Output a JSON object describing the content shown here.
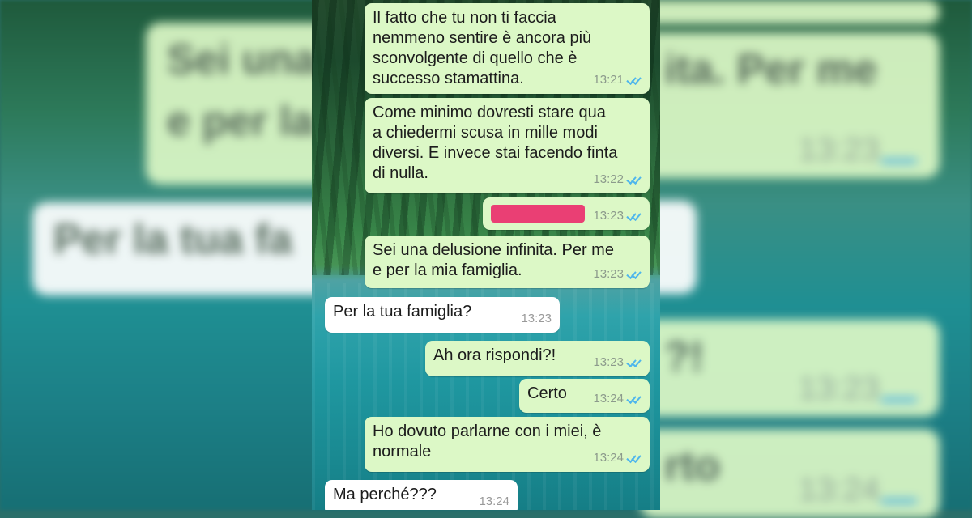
{
  "colors": {
    "outgoing_bubble": "#dcf8c6",
    "incoming_bubble": "#ffffff",
    "read_ticks": "#4fb6ec",
    "redaction": "#ea3f74"
  },
  "messages": [
    {
      "direction": "outgoing",
      "text": "Il fatto che tu non ti faccia\nnemmeno sentire è ancora più\nsconvolgente di quello che è\nsuccesso stamattina.",
      "time": "13:21",
      "status": "read"
    },
    {
      "direction": "outgoing",
      "text": "Come minimo dovresti stare qua\na chiedermi scusa in mille modi\ndiversi. E invece stai facendo finta\ndi nulla.",
      "time": "13:22",
      "status": "read"
    },
    {
      "direction": "outgoing",
      "text": "",
      "redacted": true,
      "time": "13:23",
      "status": "read"
    },
    {
      "direction": "outgoing",
      "text": "Sei una delusione infinita. Per me\ne per la mia famiglia.",
      "time": "13:23",
      "status": "read"
    },
    {
      "direction": "incoming",
      "text": "Per la tua famiglia?",
      "time": "13:23"
    },
    {
      "direction": "outgoing",
      "text": "Ah ora rispondi?!",
      "time": "13:23",
      "status": "read"
    },
    {
      "direction": "outgoing",
      "text": "Certo",
      "time": "13:24",
      "status": "read"
    },
    {
      "direction": "outgoing",
      "text": "Ho dovuto parlarne con i miei, è\nnormale",
      "time": "13:24",
      "status": "read"
    },
    {
      "direction": "incoming",
      "text": "Ma perché???",
      "time": "13:24"
    }
  ],
  "background_ghosts": {
    "left_outgoing_top": "Sei una",
    "left_outgoing_mid": "e per la",
    "left_incoming": "Per la tua fa",
    "right_outgoing_top": "ita. Per me",
    "right_time_1": "13:23",
    "right_time_2": "13:23",
    "right_time_3": "13:24",
    "right_fragment_1": "?!",
    "right_fragment_2": "rto"
  }
}
